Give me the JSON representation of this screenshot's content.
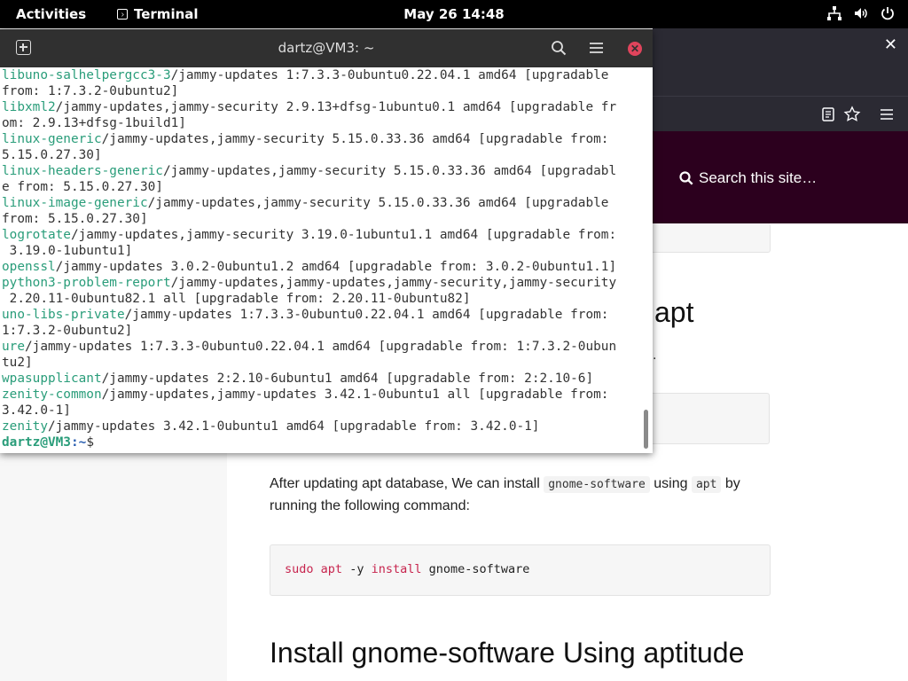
{
  "topbar": {
    "activities": "Activities",
    "app_name": "Terminal",
    "clock": "May 26  14:48"
  },
  "terminal": {
    "title": "dartz@VM3: ~",
    "lines": [
      {
        "pkg": "libuno-salhelpergcc3-3",
        "rest": "/jammy-updates 1:7.3.3-0ubuntu0.22.04.1 amd64 [upgradable"
      },
      {
        "pkg": "",
        "rest": "from: 1:7.3.2-0ubuntu2]"
      },
      {
        "pkg": "libxml2",
        "rest": "/jammy-updates,jammy-security 2.9.13+dfsg-1ubuntu0.1 amd64 [upgradable fr"
      },
      {
        "pkg": "",
        "rest": "om: 2.9.13+dfsg-1build1]"
      },
      {
        "pkg": "linux-generic",
        "rest": "/jammy-updates,jammy-security 5.15.0.33.36 amd64 [upgradable from:"
      },
      {
        "pkg": "",
        "rest": "5.15.0.27.30]"
      },
      {
        "pkg": "linux-headers-generic",
        "rest": "/jammy-updates,jammy-security 5.15.0.33.36 amd64 [upgradabl"
      },
      {
        "pkg": "",
        "rest": "e from: 5.15.0.27.30]"
      },
      {
        "pkg": "linux-image-generic",
        "rest": "/jammy-updates,jammy-security 5.15.0.33.36 amd64 [upgradable"
      },
      {
        "pkg": "",
        "rest": "from: 5.15.0.27.30]"
      },
      {
        "pkg": "logrotate",
        "rest": "/jammy-updates,jammy-security 3.19.0-1ubuntu1.1 amd64 [upgradable from:"
      },
      {
        "pkg": "",
        "rest": " 3.19.0-1ubuntu1]"
      },
      {
        "pkg": "openssl",
        "rest": "/jammy-updates 3.0.2-0ubuntu1.2 amd64 [upgradable from: 3.0.2-0ubuntu1.1]"
      },
      {
        "pkg": "python3-problem-report",
        "rest": "/jammy-updates,jammy-updates,jammy-security,jammy-security"
      },
      {
        "pkg": "",
        "rest": " 2.20.11-0ubuntu82.1 all [upgradable from: 2.20.11-0ubuntu82]"
      },
      {
        "pkg": "uno-libs-private",
        "rest": "/jammy-updates 1:7.3.3-0ubuntu0.22.04.1 amd64 [upgradable from:"
      },
      {
        "pkg": "",
        "rest": "1:7.3.2-0ubuntu2]"
      },
      {
        "pkg": "ure",
        "rest": "/jammy-updates 1:7.3.3-0ubuntu0.22.04.1 amd64 [upgradable from: 1:7.3.2-0ubun"
      },
      {
        "pkg": "",
        "rest": "tu2]"
      },
      {
        "pkg": "wpasupplicant",
        "rest": "/jammy-updates 2:2.10-6ubuntu1 amd64 [upgradable from: 2:2.10-6]"
      },
      {
        "pkg": "zenity-common",
        "rest": "/jammy-updates,jammy-updates 3.42.1-0ubuntu1 all [upgradable from:"
      },
      {
        "pkg": "",
        "rest": "3.42.0-1]"
      },
      {
        "pkg": "zenity",
        "rest": "/jammy-updates 3.42.1-0ubuntu1 amd64 [upgradable from: 3.42.0-1]"
      }
    ],
    "prompt_user": "dartz@VM3",
    "prompt_path": ":~",
    "prompt_symbol": "$"
  },
  "browser": {
    "site_search": "Search this site…"
  },
  "article": {
    "heading_partial": "apt",
    "dot_partial": ".",
    "para_before": "After updating apt database, We can install ",
    "para_code1": "gnome-software",
    "para_mid": " using ",
    "para_code2": "apt",
    "para_after": " by running the following command:",
    "cmd_sudo": "sudo",
    "cmd_apt": "apt",
    "cmd_flag": "-y",
    "cmd_install": "install",
    "cmd_pkg": "gnome-software",
    "section_heading": "Install gnome-software Using aptitude"
  },
  "colors": {
    "pkg_green": "#2a9d7a",
    "prompt_blue": "#2a5fb0",
    "site_header": "#2c001e",
    "close_red": "#e0445c"
  }
}
